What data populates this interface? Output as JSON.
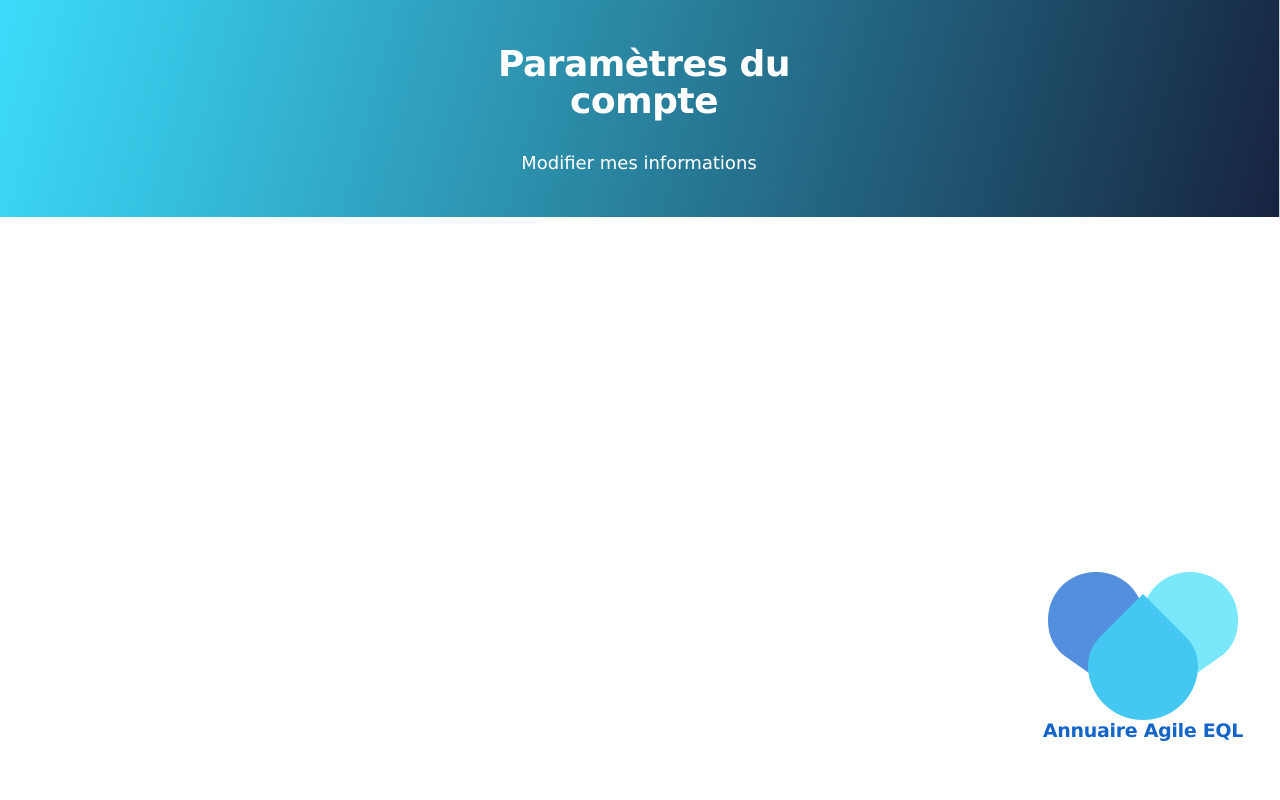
{
  "header": {
    "title": "Paramètres du compte",
    "subtitle": "Modifier mes informations",
    "gradient_start": "#3ddcfa",
    "gradient_end": "#17233f"
  },
  "brand": {
    "name": "Annuaire Agile EQL",
    "logo_icon": "heart-logo-icon",
    "text_color": "#1565c8",
    "logo_colors": [
      "#548fde",
      "#7ae8fb",
      "#44c8f2"
    ]
  }
}
